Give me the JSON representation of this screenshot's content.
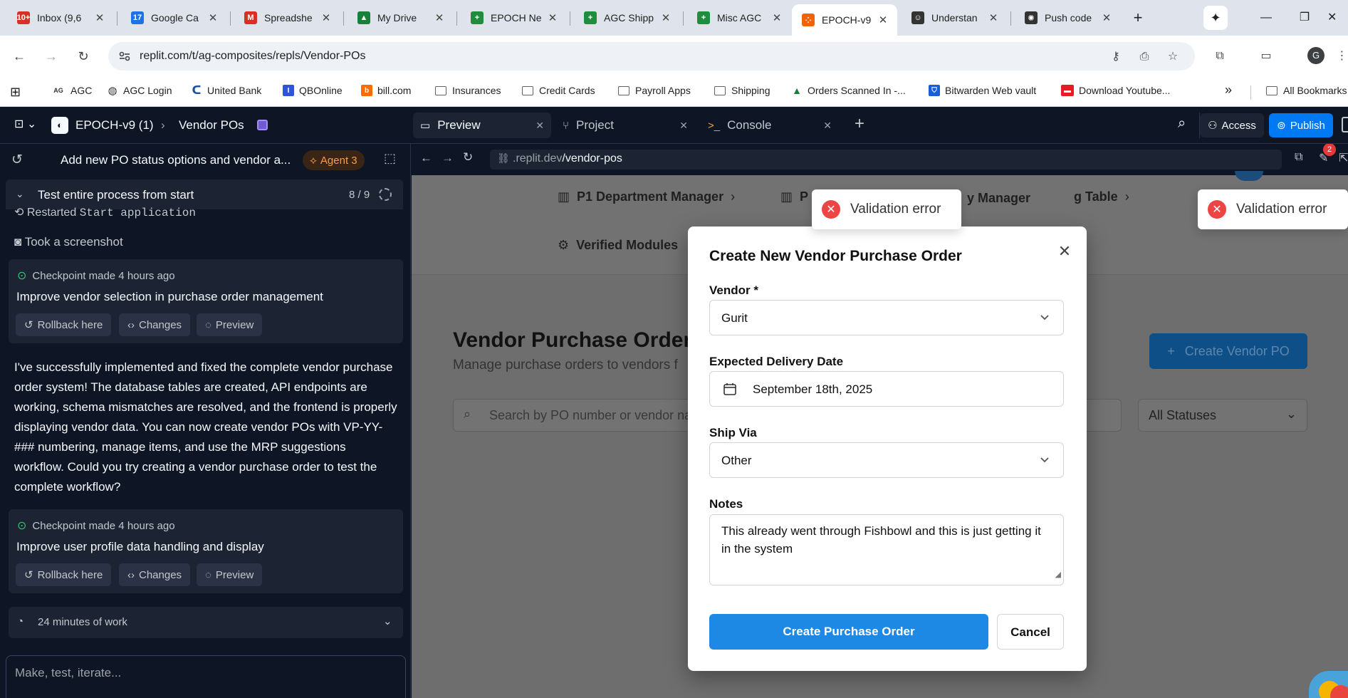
{
  "browser": {
    "tabs": [
      {
        "title": "Inbox (9,6",
        "icon": "gmail-icon",
        "color": "#d93025",
        "badge": "10+"
      },
      {
        "title": "Google Ca",
        "icon": "calendar-icon",
        "color": "#1a73e8",
        "badge": "17"
      },
      {
        "title": "Spreadshe",
        "icon": "gmail-icon",
        "color": "#d93025",
        "badge": "M"
      },
      {
        "title": "My Drive",
        "icon": "drive-icon",
        "color": "#188038",
        "badge": "▲"
      },
      {
        "title": "EPOCH Ne",
        "icon": "sheets-icon",
        "color": "#1e8e3e",
        "badge": "+"
      },
      {
        "title": "AGC Shipp",
        "icon": "sheets-icon",
        "color": "#1e8e3e",
        "badge": "+"
      },
      {
        "title": "Misc AGC",
        "icon": "sheets-icon",
        "color": "#1e8e3e",
        "badge": "+"
      },
      {
        "title": "EPOCH-v9",
        "icon": "replit-icon",
        "color": "#f26207",
        "badge": "⁘"
      },
      {
        "title": "Understan",
        "icon": "copilot-icon",
        "color": "#333333",
        "badge": "☺"
      },
      {
        "title": "Push code",
        "icon": "openai-icon",
        "color": "#333333",
        "badge": "✺"
      }
    ],
    "url": "replit.com/t/ag-composites/repls/Vendor-POs",
    "bookmarks": [
      {
        "label": "AGC",
        "type": "text-icon",
        "glyph": "AG"
      },
      {
        "label": "AGC Login",
        "type": "globe"
      },
      {
        "label": "United Bank",
        "type": "swoosh"
      },
      {
        "label": "QBOnline",
        "type": "square",
        "glyph": "I",
        "color": "#2d55d6"
      },
      {
        "label": "bill.com",
        "type": "square",
        "glyph": "b",
        "color": "#ff6b00"
      },
      {
        "label": "Insurances",
        "type": "folder"
      },
      {
        "label": "Credit Cards",
        "type": "folder"
      },
      {
        "label": "Payroll Apps",
        "type": "folder"
      },
      {
        "label": "Shipping",
        "type": "folder"
      },
      {
        "label": "Orders Scanned In -...",
        "type": "drive"
      },
      {
        "label": "Bitwarden Web vault",
        "type": "square",
        "glyph": "⛉",
        "color": "#175ddc"
      },
      {
        "label": "Download Youtube...",
        "type": "square",
        "glyph": "▬",
        "color": "#e51c23"
      }
    ],
    "more_label": "»",
    "all_bookmarks": "All Bookmarks",
    "avatar": "G"
  },
  "replit": {
    "project": "EPOCH-v9 (1)",
    "breadcrumb": "Vendor POs",
    "tabs": [
      {
        "label": "Preview",
        "icon": "monitor-icon"
      },
      {
        "label": "Project",
        "icon": "branch-icon"
      },
      {
        "label": "Console",
        "icon": "terminal-icon"
      }
    ],
    "access": "Access",
    "publish": "Publish",
    "agent": {
      "thread_title": "Add new PO status options and vendor a...",
      "badge": "Agent 3",
      "section": "Test entire process from start",
      "progress": "8 / 9",
      "restarted_prefix": "Restarted",
      "restarted_code": "Start application",
      "screenshot": "Took a screenshot",
      "checkpoints": [
        {
          "meta": "Checkpoint made 4 hours ago",
          "title": "Improve vendor selection in purchase order management"
        },
        {
          "meta": "Checkpoint made 4 hours ago",
          "title": "Improve user profile data handling and display"
        }
      ],
      "actions": {
        "rollback": "Rollback here",
        "changes": "Changes",
        "preview": "Preview"
      },
      "message": "I've successfully implemented and fixed the complete vendor purchase order system! The database tables are created, API endpoints are working, schema mismatches are resolved, and the frontend is properly displaying vendor data. You can now create vendor POs with VP-YY-### numbering, manage items, and use the MRP suggestions workflow. Could you try creating a vendor purchase order to test the complete workflow?",
      "work": "24 minutes of work",
      "input_placeholder": "Make, test, iterate..."
    },
    "preview_url_host": ".replit.dev",
    "preview_url_path": "/vendor-pos",
    "notif_count": "2"
  },
  "app": {
    "nav": [
      "P1 Department Manager",
      "P",
      "y Manager",
      "g Table",
      "Verified Modules"
    ],
    "page_title": "Vendor Purchase Orders",
    "page_subtitle": "Manage purchase orders to vendors f",
    "create_button": "Create Vendor PO",
    "search_placeholder": "Search by PO number or vendor nar",
    "status_filter": "All Statuses"
  },
  "modal": {
    "title": "Create New Vendor Purchase Order",
    "vendor_label": "Vendor *",
    "vendor_value": "Gurit",
    "date_label": "Expected Delivery Date",
    "date_value": "September 18th, 2025",
    "ship_label": "Ship Via",
    "ship_value": "Other",
    "notes_label": "Notes",
    "notes_value": "This already went through Fishbowl and this is just getting it in the system",
    "submit": "Create Purchase Order",
    "cancel": "Cancel"
  },
  "toasts": [
    "Validation error",
    "Validation error"
  ],
  "colors": {
    "accent": "#1e88e5",
    "publish": "#0079f2",
    "error": "#ef4444",
    "agent_badge": "#f59e4a"
  }
}
